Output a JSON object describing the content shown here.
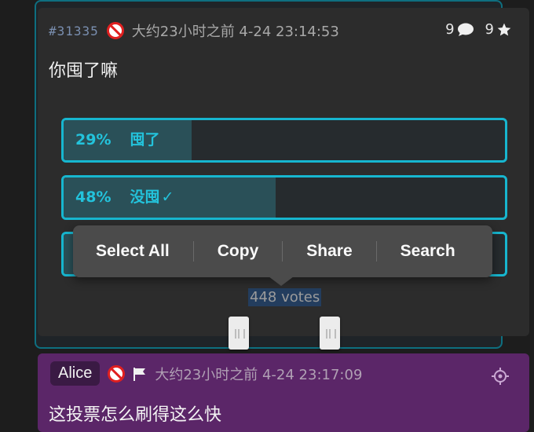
{
  "post": {
    "id": "#31335",
    "time": "大约23小时之前 4-24 23:14:53",
    "reply_count": "9",
    "star_count": "9",
    "body": "你囤了嘛"
  },
  "poll": {
    "options": [
      {
        "percent_label": "29%",
        "label": "囤了",
        "fraction": 0.29,
        "voted": false
      },
      {
        "percent_label": "48%",
        "label": "没囤",
        "fraction": 0.48,
        "voted": true,
        "check": "✓"
      },
      {
        "fraction": 0.23
      }
    ],
    "total_votes": "448 votes"
  },
  "context_menu": {
    "items": [
      "Select All",
      "Copy",
      "Share",
      "Search"
    ]
  },
  "reply": {
    "author": "Alice",
    "time": "大约23小时之前 4-24 23:17:09",
    "body": "这投票怎么刷得这么快"
  },
  "colors": {
    "accent": "#17b6cf",
    "post_bg": "#2c2c2c",
    "reply_bg": "#5b2668",
    "menu_bg": "#4b4b4b"
  },
  "icons": [
    "ban-icon",
    "chat-icon",
    "star-icon",
    "flag-icon",
    "locate-icon"
  ]
}
